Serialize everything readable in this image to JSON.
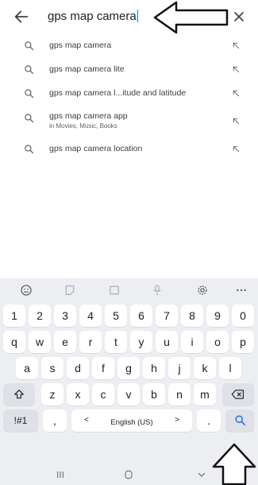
{
  "search": {
    "query": "gps map camera",
    "back_icon": "arrow-back-icon",
    "clear_icon": "close-icon"
  },
  "suggestions": [
    {
      "text": "gps map camera",
      "sub": ""
    },
    {
      "text": "gps map camera lite",
      "sub": ""
    },
    {
      "text": "gps map camera l...itude and latitude",
      "sub": ""
    },
    {
      "text": "gps map camera app",
      "sub": "in Movies, Music, Books"
    },
    {
      "text": "gps map camera location",
      "sub": ""
    }
  ],
  "keyboard": {
    "toolbar": [
      "emoji-icon",
      "sticker-icon",
      "gif-icon",
      "mic-icon",
      "settings-icon",
      "more-icon"
    ],
    "numbers": [
      "1",
      "2",
      "3",
      "4",
      "5",
      "6",
      "7",
      "8",
      "9",
      "0"
    ],
    "row1": [
      "q",
      "w",
      "e",
      "r",
      "t",
      "y",
      "u",
      "i",
      "o",
      "p"
    ],
    "row2": [
      "a",
      "s",
      "d",
      "f",
      "g",
      "h",
      "j",
      "k",
      "l"
    ],
    "row3": [
      "z",
      "x",
      "c",
      "v",
      "b",
      "n",
      "m"
    ],
    "sym_label": "!#1",
    "comma": ",",
    "lang_left": "<",
    "language": "English (US)",
    "lang_right": ">",
    "period": ".",
    "shift_icon": "shift-icon",
    "backspace_icon": "backspace-icon",
    "search_icon": "search-icon"
  },
  "colors": {
    "accent": "#1a73e8",
    "keyboard_bg": "#eceef2",
    "key_bg": "#ffffff",
    "fn_key_bg": "#dfe1e6"
  }
}
